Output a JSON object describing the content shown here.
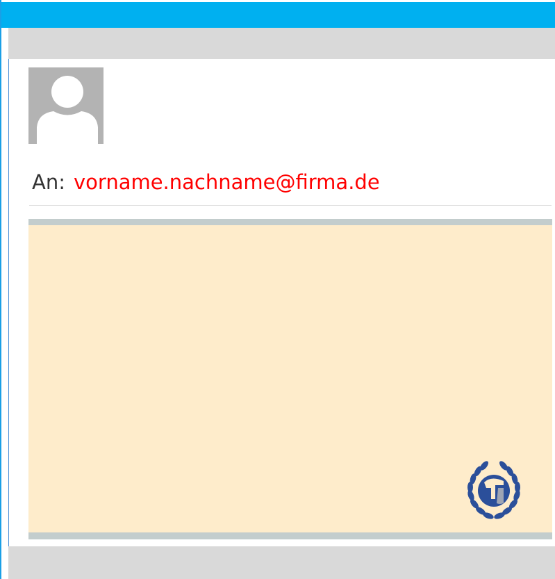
{
  "message": {
    "to_label": "An:",
    "to_address": "vorname.nachname@firma.de"
  },
  "icons": {
    "avatar": "user-silhouette-icon",
    "seal": "spartan-helmet-laurel-icon"
  },
  "colors": {
    "top_bar": "#00b0f0",
    "header_gray": "#d9d9d9",
    "avatar_bg": "#b3b3b3",
    "address_text": "#ff0000",
    "content_frame": "#c3cdcd",
    "content_bg": "#feeccb",
    "seal_blue": "#2b4f9a"
  }
}
